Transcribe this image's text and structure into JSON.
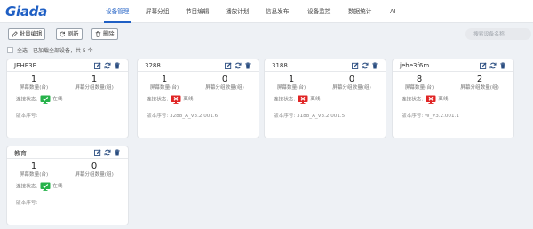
{
  "logo": "Giada",
  "nav": {
    "items": [
      {
        "label": "设备管理",
        "active": true
      },
      {
        "label": "屏幕分组"
      },
      {
        "label": "节目编辑"
      },
      {
        "label": "播放计划"
      },
      {
        "label": "信息发布"
      },
      {
        "label": "设备监控"
      },
      {
        "label": "数据统计"
      },
      {
        "label": "AI"
      }
    ]
  },
  "toolbar": {
    "batch_edit": "批量编辑",
    "refresh": "刷新",
    "delete": "删除",
    "search_placeholder": "搜索设备名称",
    "select_all": "全选",
    "loaded_msg": "已加载全部设备，共 5 个"
  },
  "labels": {
    "screen_count": "屏幕数量(台)",
    "group_count": "屏幕分组数量(组)",
    "conn_status": "连接状态:",
    "version": "版本序号:"
  },
  "status": {
    "online": "在线",
    "offline": "离线"
  },
  "colors": {
    "accent": "#1f5fc4",
    "online": "#26b24a",
    "offline": "#e02424"
  },
  "devices": [
    {
      "name": "JEHE3F",
      "screens": "1",
      "groups": "1",
      "status": "online",
      "version": ""
    },
    {
      "name": "3288",
      "screens": "1",
      "groups": "0",
      "status": "offline",
      "version": "3288_A_V3.2.001.6"
    },
    {
      "name": "3188",
      "screens": "1",
      "groups": "0",
      "status": "offline",
      "version": "3188_A_V3.2.001.5"
    },
    {
      "name": "jehe3f6m",
      "screens": "8",
      "groups": "2",
      "status": "offline",
      "version": "W_V3.2.001.1"
    },
    {
      "name": "教育",
      "screens": "1",
      "groups": "0",
      "status": "online",
      "version": ""
    }
  ]
}
